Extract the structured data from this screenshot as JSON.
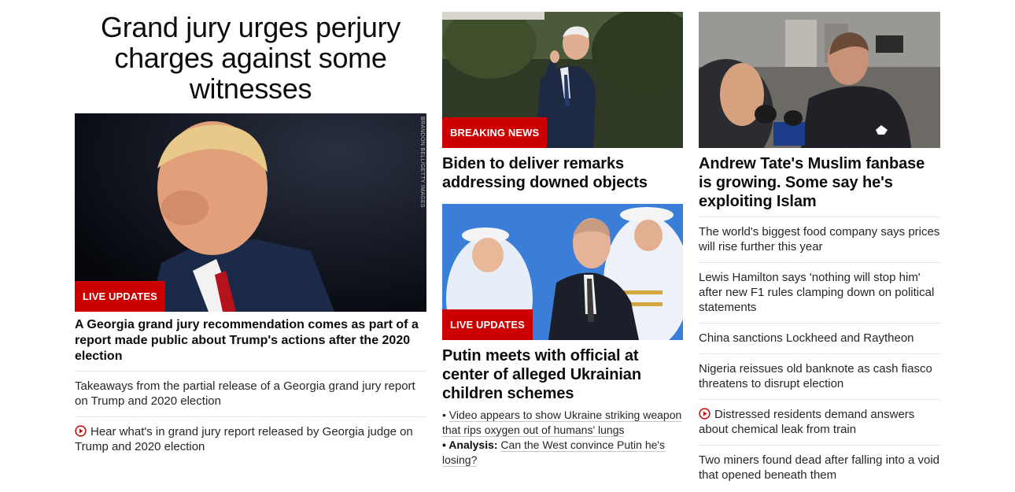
{
  "left": {
    "lead_title": "Grand jury urges perjury charges against some witnesses",
    "image_tag": "LIVE UPDATES",
    "image_credit": "BRANDON BELL/GETTY IMAGES",
    "headline": "A Georgia grand jury recommendation comes as part of a report made public about Trump's actions after the 2020 election",
    "links": [
      {
        "text": "Takeaways from the partial release of a Georgia grand jury report on Trump and 2020 election",
        "video": false
      },
      {
        "text": "Hear what's in grand jury report released by Georgia judge on Trump and 2020 election",
        "video": true
      }
    ]
  },
  "middle": {
    "story1": {
      "tag": "BREAKING NEWS",
      "headline": "Biden to deliver remarks addressing downed objects"
    },
    "story2": {
      "tag": "LIVE UPDATES",
      "headline": "Putin meets with official at center of alleged Ukrainian children schemes",
      "sub1": "Video appears to show Ukraine striking weapon that rips oxygen out of humans' lungs",
      "sub2_label": "Analysis:",
      "sub2": "Can the West convince Putin he's losing?",
      "bullet": "•"
    }
  },
  "right": {
    "headline": "Andrew Tate's Muslim fanbase is growing. Some say he's exploiting Islam",
    "links": [
      {
        "text": "The world's biggest food company says prices will rise further this year",
        "video": false
      },
      {
        "text": "Lewis Hamilton says 'nothing will stop him' after new F1 rules clamping down on political statements",
        "video": false
      },
      {
        "text": "China sanctions Lockheed and Raytheon",
        "video": false
      },
      {
        "text": "Nigeria reissues old banknote as cash fiasco threatens to disrupt election",
        "video": false
      },
      {
        "text": "Distressed residents demand answers about chemical leak from train",
        "video": true
      },
      {
        "text": "Two miners found dead after falling into a void that opened beneath them",
        "video": false
      }
    ]
  },
  "colors": {
    "tag_red": "#cc0000",
    "text": "#0c0c0c",
    "divider": "#e6e6e6"
  }
}
